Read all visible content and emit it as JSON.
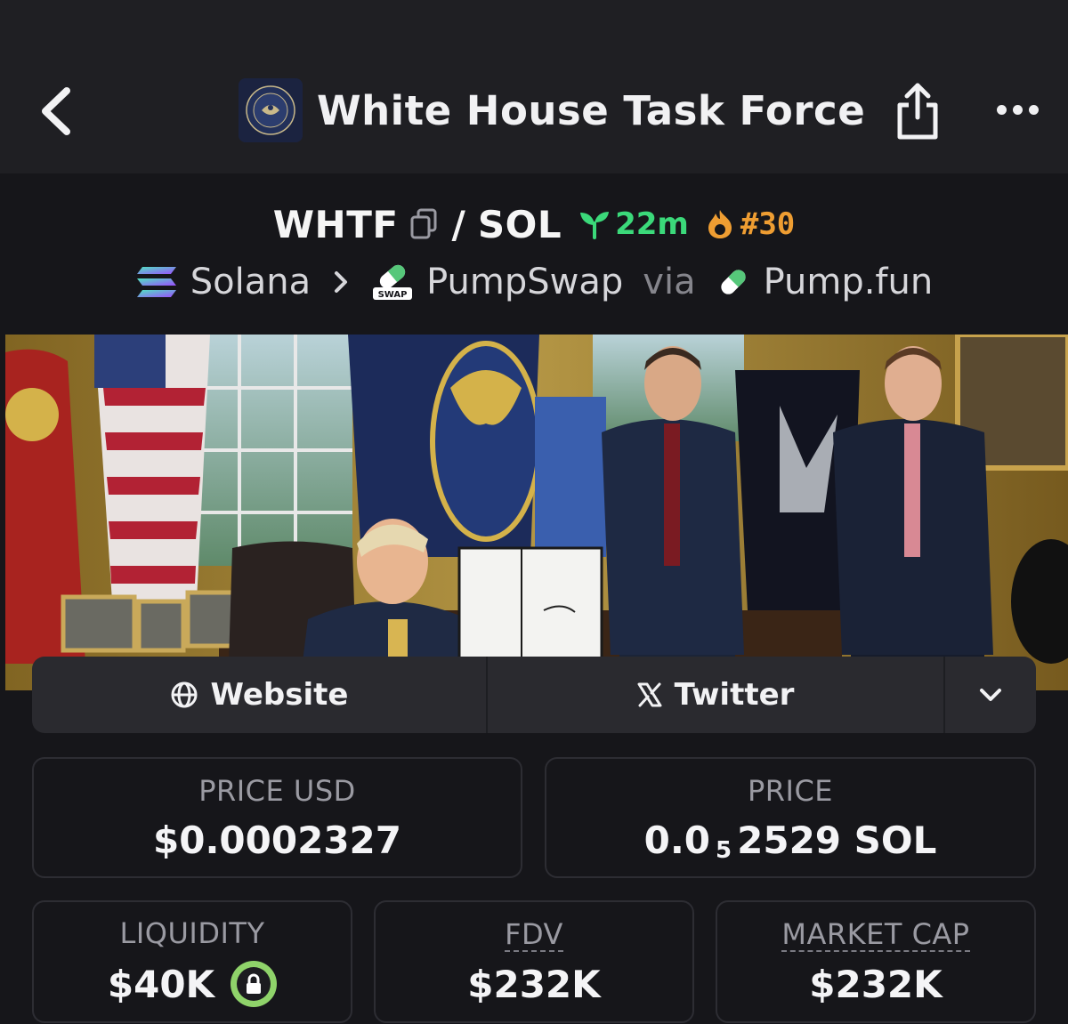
{
  "header": {
    "title": "White House Task Force",
    "back_icon": "chevron-left-icon",
    "share_icon": "share-icon",
    "more_icon": "more-horizontal-icon"
  },
  "pair": {
    "base": "WHTF",
    "separator": "/",
    "quote": "SOL",
    "age": "22m",
    "rank": "#30",
    "age_color": "#3bd97a",
    "rank_color": "#ee9d32"
  },
  "chain": {
    "network": "Solana",
    "dex": "PumpSwap",
    "dex_badge": "SWAP",
    "via": "via",
    "launchpad": "Pump.fun"
  },
  "links": {
    "website": "Website",
    "twitter": "Twitter"
  },
  "stats": {
    "price_usd": {
      "label": "PRICE USD",
      "value": "$0.0002327"
    },
    "price": {
      "label": "PRICE",
      "value_prefix": "0.0",
      "value_sub": "5",
      "value_rest": "2529 SOL"
    },
    "liquidity": {
      "label": "LIQUIDITY",
      "value": "$40K"
    },
    "fdv": {
      "label": "FDV",
      "value": "$232K"
    },
    "market_cap": {
      "label": "MARKET CAP",
      "value": "$232K"
    }
  }
}
